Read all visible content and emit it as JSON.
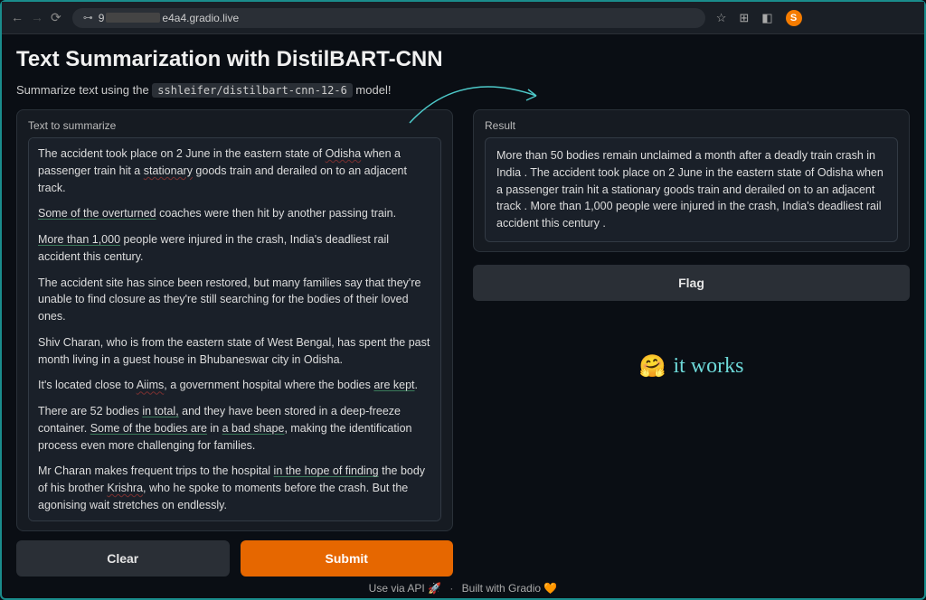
{
  "browser": {
    "url_prefix": "9",
    "url_suffix": "e4a4.gradio.live",
    "avatar_letter": "S"
  },
  "header": {
    "title": "Text Summarization with DistilBART-CNN",
    "subtitle_before": "Summarize text using the ",
    "subtitle_code": "sshleifer/distilbart-cnn-12-6",
    "subtitle_after": " model!"
  },
  "input": {
    "label": "Text to summarize",
    "paragraphs": [
      {
        "segments": [
          {
            "t": "The accident took place on 2 June in the eastern state of ",
            "c": ""
          },
          {
            "t": "Odisha",
            "c": "spellerr"
          },
          {
            "t": " when a passenger train hit a ",
            "c": ""
          },
          {
            "t": "stationary",
            "c": "spellerr"
          },
          {
            "t": " goods train and derailed on to an adjacent track.",
            "c": ""
          }
        ]
      },
      {
        "segments": [
          {
            "t": "Some of the overturned",
            "c": "grammar"
          },
          {
            "t": " coaches were then hit by another passing train.",
            "c": ""
          }
        ]
      },
      {
        "segments": [
          {
            "t": "More than 1,000",
            "c": "grammar"
          },
          {
            "t": " people were injured in the crash, India's deadliest rail accident this century.",
            "c": ""
          }
        ]
      },
      {
        "segments": [
          {
            "t": "The accident site has since been restored, but many families say that they're unable to find closure as they're still searching for the bodies of their loved ones.",
            "c": ""
          }
        ]
      },
      {
        "segments": [
          {
            "t": "Shiv Charan, who is from the eastern state of West Bengal, has spent the past month living in a guest house in Bhubaneswar city in Odisha.",
            "c": ""
          }
        ]
      },
      {
        "segments": [
          {
            "t": "It's located close to ",
            "c": ""
          },
          {
            "t": "Aiims",
            "c": "spellerr"
          },
          {
            "t": ", a government hospital where the bodies ",
            "c": ""
          },
          {
            "t": "are kept",
            "c": "grammar"
          },
          {
            "t": ".",
            "c": ""
          }
        ]
      },
      {
        "segments": [
          {
            "t": "There are 52 bodies ",
            "c": ""
          },
          {
            "t": "in total,",
            "c": "grammar"
          },
          {
            "t": " and they have been stored in a deep-freeze container. ",
            "c": ""
          },
          {
            "t": "Some of the bodies are",
            "c": "grammar"
          },
          {
            "t": " in ",
            "c": ""
          },
          {
            "t": "a bad shape",
            "c": "grammar"
          },
          {
            "t": ", making the identification process even more challenging for families.",
            "c": ""
          }
        ]
      },
      {
        "segments": [
          {
            "t": "Mr Charan makes frequent trips to the hospital ",
            "c": ""
          },
          {
            "t": "in the hope of finding",
            "c": "grammar"
          },
          {
            "t": " the body of his brother ",
            "c": ""
          },
          {
            "t": "Krishra",
            "c": "spellerr"
          },
          {
            "t": ", who he spoke to moments before the crash. But the agonising wait stretches on endlessly.",
            "c": ""
          }
        ]
      }
    ]
  },
  "output": {
    "label": "Result",
    "text": "More than 50 bodies remain unclaimed a month after a deadly train crash in India . The accident took place on 2 June in the eastern state of Odisha when a passenger train hit a stationary goods train and derailed on to an adjacent track . More than 1,000 people were injured in the crash, India's deadliest rail accident this century ."
  },
  "buttons": {
    "clear": "Clear",
    "submit": "Submit",
    "flag": "Flag"
  },
  "annotation": {
    "emoji": "🤗",
    "text": "it works"
  },
  "footer": {
    "api": "Use via API 🚀",
    "sep": "·",
    "gradio": "Built with Gradio 🧡"
  }
}
